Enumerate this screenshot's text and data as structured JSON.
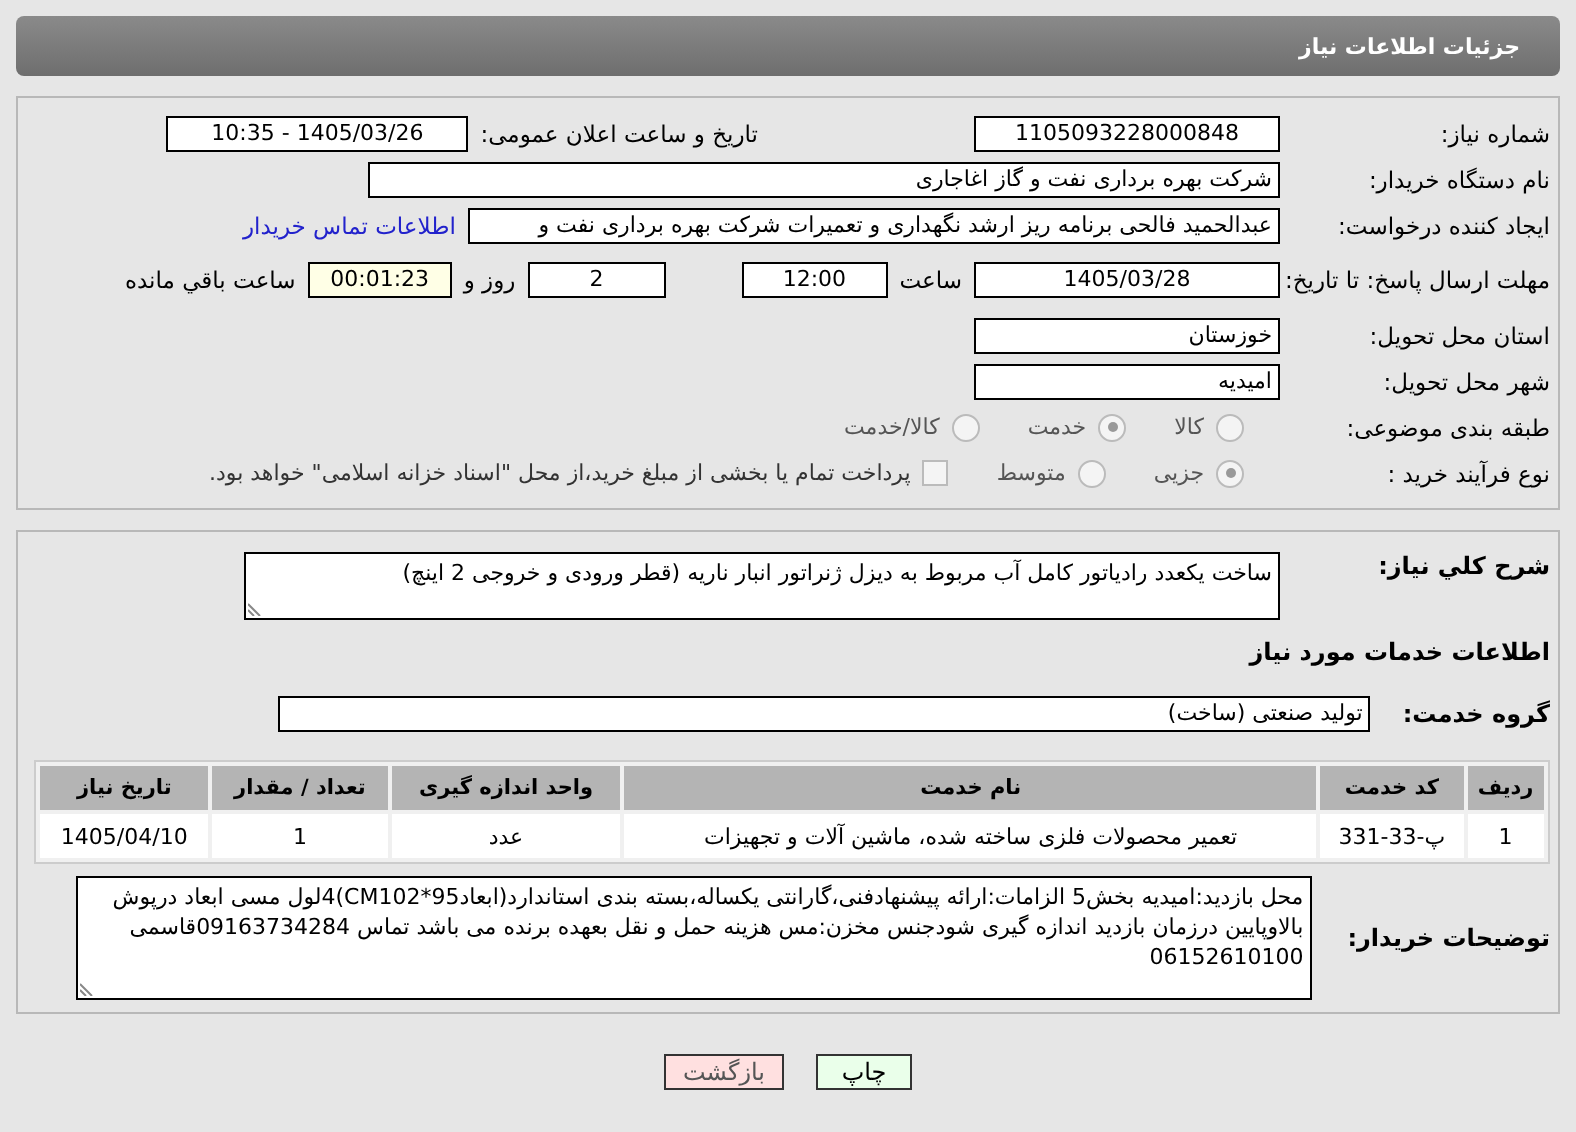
{
  "header": {
    "title": "جزئیات اطلاعات نیاز"
  },
  "need_number": {
    "label": "شماره نیاز:",
    "value": "1105093228000848"
  },
  "announce": {
    "label": "تاریخ و ساعت اعلان عمومی:",
    "value": "1405/03/26 - 10:35"
  },
  "buyer_org": {
    "label": "نام دستگاه خریدار:",
    "value": "شرکت بهره برداری نفت و گاز اغاجاری"
  },
  "requester": {
    "label": "ایجاد کننده درخواست:",
    "value": "عبدالحمید فالحی برنامه ریز ارشد نگهداری و تعمیرات شرکت بهره برداری نفت و",
    "link": "اطلاعات تماس خریدار"
  },
  "deadline": {
    "label": "مهلت ارسال پاسخ: تا تاریخ:",
    "date": "1405/03/28",
    "time_label": "ساعت",
    "time": "12:00",
    "days": "2",
    "days_label": "روز و",
    "remaining": "00:01:23",
    "remaining_label": "ساعت باقي مانده"
  },
  "province": {
    "label": "استان محل تحویل:",
    "value": "خوزستان"
  },
  "city": {
    "label": "شهر محل تحویل:",
    "value": "امیدیه"
  },
  "category": {
    "label": "طبقه بندی موضوعی:",
    "options": [
      {
        "label": "کالا",
        "selected": false
      },
      {
        "label": "خدمت",
        "selected": true
      },
      {
        "label": "کالا/خدمت",
        "selected": false
      }
    ]
  },
  "process": {
    "label": "نوع فرآیند خرید :",
    "options": [
      {
        "label": "جزیی",
        "selected": true
      },
      {
        "label": "متوسط",
        "selected": false
      }
    ],
    "treasury": {
      "checked": false,
      "label": "پرداخت تمام یا بخشی از مبلغ خرید،از محل \"اسناد خزانه اسلامی\" خواهد بود."
    }
  },
  "description": {
    "label": "شرح کلي نیاز:",
    "value": "ساخت یکعدد رادیاتور کامل آب مربوط به دیزل ژنراتور انبار ناریه (قطر ورودی و خروجی 2 اینچ)"
  },
  "services_title": "اطلاعات خدمات مورد نیاز",
  "service_group": {
    "label": "گروه خدمت:",
    "value": "تولید صنعتی (ساخت)"
  },
  "table": {
    "columns": [
      "ردیف",
      "کد خدمت",
      "نام خدمت",
      "واحد اندازه گیری",
      "تعداد / مقدار",
      "تاریخ نیاز"
    ],
    "rows": [
      [
        "1",
        "پ-33-331",
        "تعمیر محصولات فلزی ساخته شده، ماشین آلات و تجهیزات",
        "عدد",
        "1",
        "1405/04/10"
      ]
    ]
  },
  "buyer_notes": {
    "label": "توضیحات خریدار:",
    "value": "محل بازدید:امیدیه بخش5 الزامات:ارائه پیشنهادفنی،گارانتی یکساله،بسته بندی استاندارد(ابعاد95*CM102)4لول مسی ابعاد درپوش بالاوپایین درزمان بازدید اندازه گیری شودجنس مخزن:مس هزینه حمل و نقل بعهده برنده می باشد تماس 09163734284قاسمی 06152610100"
  },
  "buttons": [
    {
      "label": "چاپ",
      "kind": "print"
    },
    {
      "label": "بازگشت",
      "kind": "back"
    }
  ]
}
